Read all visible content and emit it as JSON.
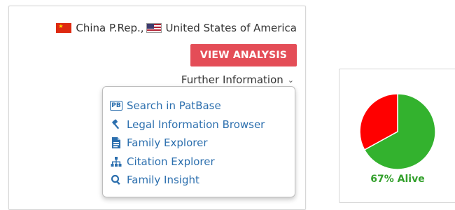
{
  "countries": {
    "china": "China P.Rep.,",
    "usa": "United States of America"
  },
  "actions": {
    "view_analysis": "VIEW ANALYSIS",
    "further_information": "Further Information"
  },
  "dropdown": {
    "items": [
      {
        "label": "Search in PatBase",
        "icon": "patbase-icon"
      },
      {
        "label": "Legal Information Browser",
        "icon": "gavel-icon"
      },
      {
        "label": "Family Explorer",
        "icon": "document-icon"
      },
      {
        "label": "Citation Explorer",
        "icon": "sitemap-icon"
      },
      {
        "label": "Family Insight",
        "icon": "search-icon"
      }
    ]
  },
  "status": {
    "alive_label": "67% Alive",
    "alive_percent": 67,
    "colors": {
      "alive": "#33b22e",
      "dead": "#ff0000"
    }
  },
  "colors": {
    "accent_button": "#e44d57",
    "link": "#2c6fae"
  }
}
